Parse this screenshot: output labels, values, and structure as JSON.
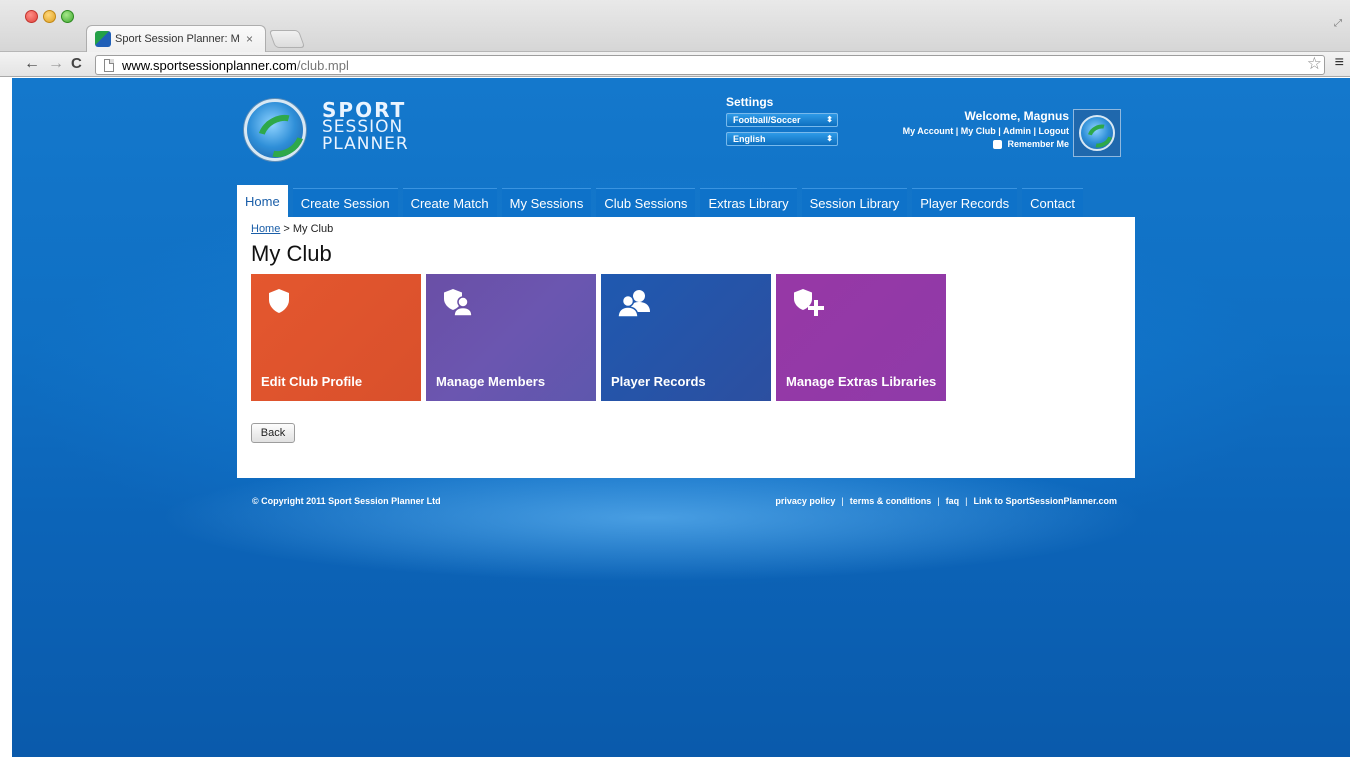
{
  "browser": {
    "tab_title": "Sport Session Planner: My",
    "url_host": "www.sportsessionplanner.com",
    "url_path": "/club.mpl"
  },
  "logo": {
    "line1": "SPORT",
    "line2": "SESSION",
    "line3": "PLANNER"
  },
  "settings": {
    "title": "Settings",
    "sport": "Football/Soccer",
    "language": "English"
  },
  "account": {
    "welcome": "Welcome, Magnus",
    "links": [
      "My Account",
      "My Club",
      "Admin",
      "Logout"
    ],
    "remember_label": "Remember Me"
  },
  "nav": {
    "items": [
      "Home",
      "Create Session",
      "Create Match",
      "My Sessions",
      "Club Sessions",
      "Extras Library",
      "Session Library",
      "Player Records",
      "Contact"
    ],
    "active": "Home"
  },
  "breadcrumb": {
    "home": "Home",
    "separator": " > ",
    "current": "My Club"
  },
  "page_title": "My Club",
  "tiles": [
    {
      "label": "Edit Club Profile",
      "icon": "shield-icon",
      "color": "#e4572e"
    },
    {
      "label": "Manage Members",
      "icon": "shield-person-icon",
      "color": "#6a4fa6"
    },
    {
      "label": "Player Records",
      "icon": "people-icon",
      "color": "#1f59b0"
    },
    {
      "label": "Manage Extras Libraries",
      "icon": "shield-plus-icon",
      "color": "#9738a6"
    }
  ],
  "back_label": "Back",
  "footer": {
    "copyright": "© Copyright 2011 Sport Session Planner Ltd",
    "links": [
      "privacy policy",
      "terms & conditions",
      "faq",
      "Link to SportSessionPlanner.com"
    ]
  }
}
